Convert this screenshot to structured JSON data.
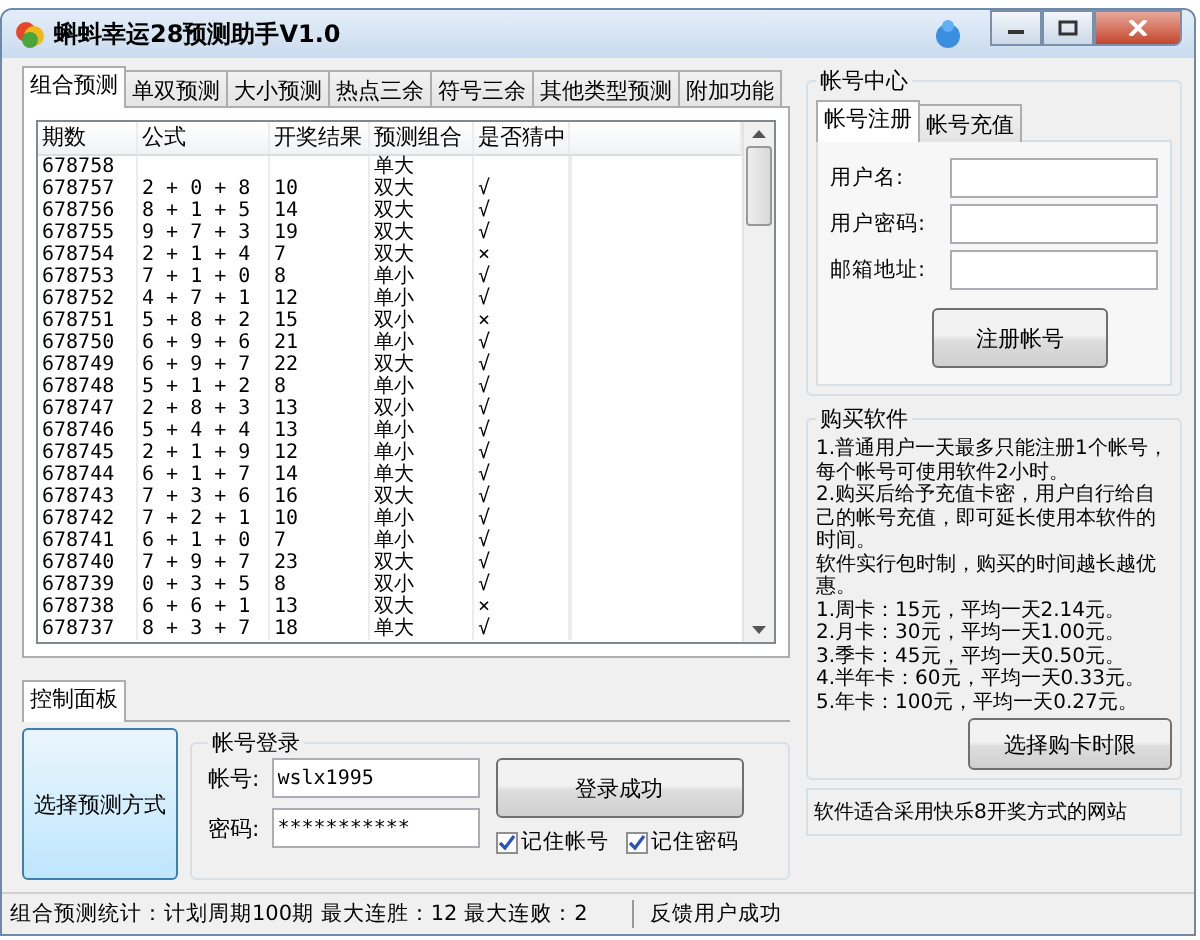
{
  "window": {
    "title": "蝌蚪幸运28预测助手V1.0"
  },
  "tabs": [
    {
      "label": "组合预测",
      "selected": true
    },
    {
      "label": "单双预测",
      "selected": false
    },
    {
      "label": "大小预测",
      "selected": false
    },
    {
      "label": "热点三余",
      "selected": false
    },
    {
      "label": "符号三余",
      "selected": false
    },
    {
      "label": "其他类型预测",
      "selected": false
    },
    {
      "label": "附加功能",
      "selected": false
    }
  ],
  "table": {
    "columns": [
      "期数",
      "公式",
      "开奖结果",
      "预测组合",
      "是否猜中"
    ],
    "rows": [
      [
        "678758",
        "",
        "",
        "单大",
        ""
      ],
      [
        "678757",
        "2 + 0 + 8",
        "10",
        "双大",
        "√"
      ],
      [
        "678756",
        "8 + 1 + 5",
        "14",
        "双大",
        "√"
      ],
      [
        "678755",
        "9 + 7 + 3",
        "19",
        "双大",
        "√"
      ],
      [
        "678754",
        "2 + 1 + 4",
        "7",
        "双大",
        "×"
      ],
      [
        "678753",
        "7 + 1 + 0",
        "8",
        "单小",
        "√"
      ],
      [
        "678752",
        "4 + 7 + 1",
        "12",
        "单小",
        "√"
      ],
      [
        "678751",
        "5 + 8 + 2",
        "15",
        "双小",
        "×"
      ],
      [
        "678750",
        "6 + 9 + 6",
        "21",
        "单小",
        "√"
      ],
      [
        "678749",
        "6 + 9 + 7",
        "22",
        "双大",
        "√"
      ],
      [
        "678748",
        "5 + 1 + 2",
        "8",
        "单小",
        "√"
      ],
      [
        "678747",
        "2 + 8 + 3",
        "13",
        "双小",
        "√"
      ],
      [
        "678746",
        "5 + 4 + 4",
        "13",
        "单小",
        "√"
      ],
      [
        "678745",
        "2 + 1 + 9",
        "12",
        "单小",
        "√"
      ],
      [
        "678744",
        "6 + 1 + 7",
        "14",
        "单大",
        "√"
      ],
      [
        "678743",
        "7 + 3 + 6",
        "16",
        "双大",
        "√"
      ],
      [
        "678742",
        "7 + 2 + 1",
        "10",
        "单小",
        "√"
      ],
      [
        "678741",
        "6 + 1 + 0",
        "7",
        "单小",
        "√"
      ],
      [
        "678740",
        "7 + 9 + 7",
        "23",
        "双大",
        "√"
      ],
      [
        "678739",
        "0 + 3 + 5",
        "8",
        "双小",
        "√"
      ],
      [
        "678738",
        "6 + 6 + 1",
        "13",
        "双大",
        "×"
      ],
      [
        "678737",
        "8 + 3 + 7",
        "18",
        "单大",
        "√"
      ]
    ]
  },
  "control_panel": {
    "tab": "控制面板",
    "choose_button": "选择预测方式",
    "login_group": "帐号登录",
    "fields": [
      {
        "label": "帐号:",
        "value": "wslx1995"
      },
      {
        "label": "密码:",
        "value": "***********"
      }
    ],
    "login_button": "登录成功",
    "checkboxes": [
      {
        "label": "记住帐号",
        "checked": true
      },
      {
        "label": "记住密码",
        "checked": true
      }
    ]
  },
  "account_center": {
    "title": "帐号中心",
    "tabs": [
      {
        "label": "帐号注册",
        "selected": true
      },
      {
        "label": "帐号充值",
        "selected": false
      }
    ],
    "fields": [
      {
        "label": "用户名:"
      },
      {
        "label": "用户密码:"
      },
      {
        "label": "邮箱地址:"
      }
    ],
    "register_button": "注册帐号"
  },
  "purchase": {
    "title": "购买软件",
    "paragraphs": [
      "1.普通用户一天最多只能注册1个帐号，每个帐号可使用软件2小时。",
      "2.购买后给予充值卡密，用户自行给自己的帐号充值，即可延长使用本软件的时间。",
      "软件实行包时制，购买的时间越长越优惠。",
      "1.周卡：15元，平均一天2.14元。",
      "2.月卡：30元，平均一天1.00元。",
      "3.季卡：45元，平均一天0.50元。",
      "4.半年卡：60元，平均一天0.33元。",
      "5.年卡：100元，平均一天0.27元。"
    ],
    "button": "选择购卡时限"
  },
  "note": "软件适合采用快乐8开奖方式的网站",
  "status_bar": [
    "组合预测统计：计划周期100期  最大连胜：12  最大连败：2",
    "反馈用户成功"
  ]
}
